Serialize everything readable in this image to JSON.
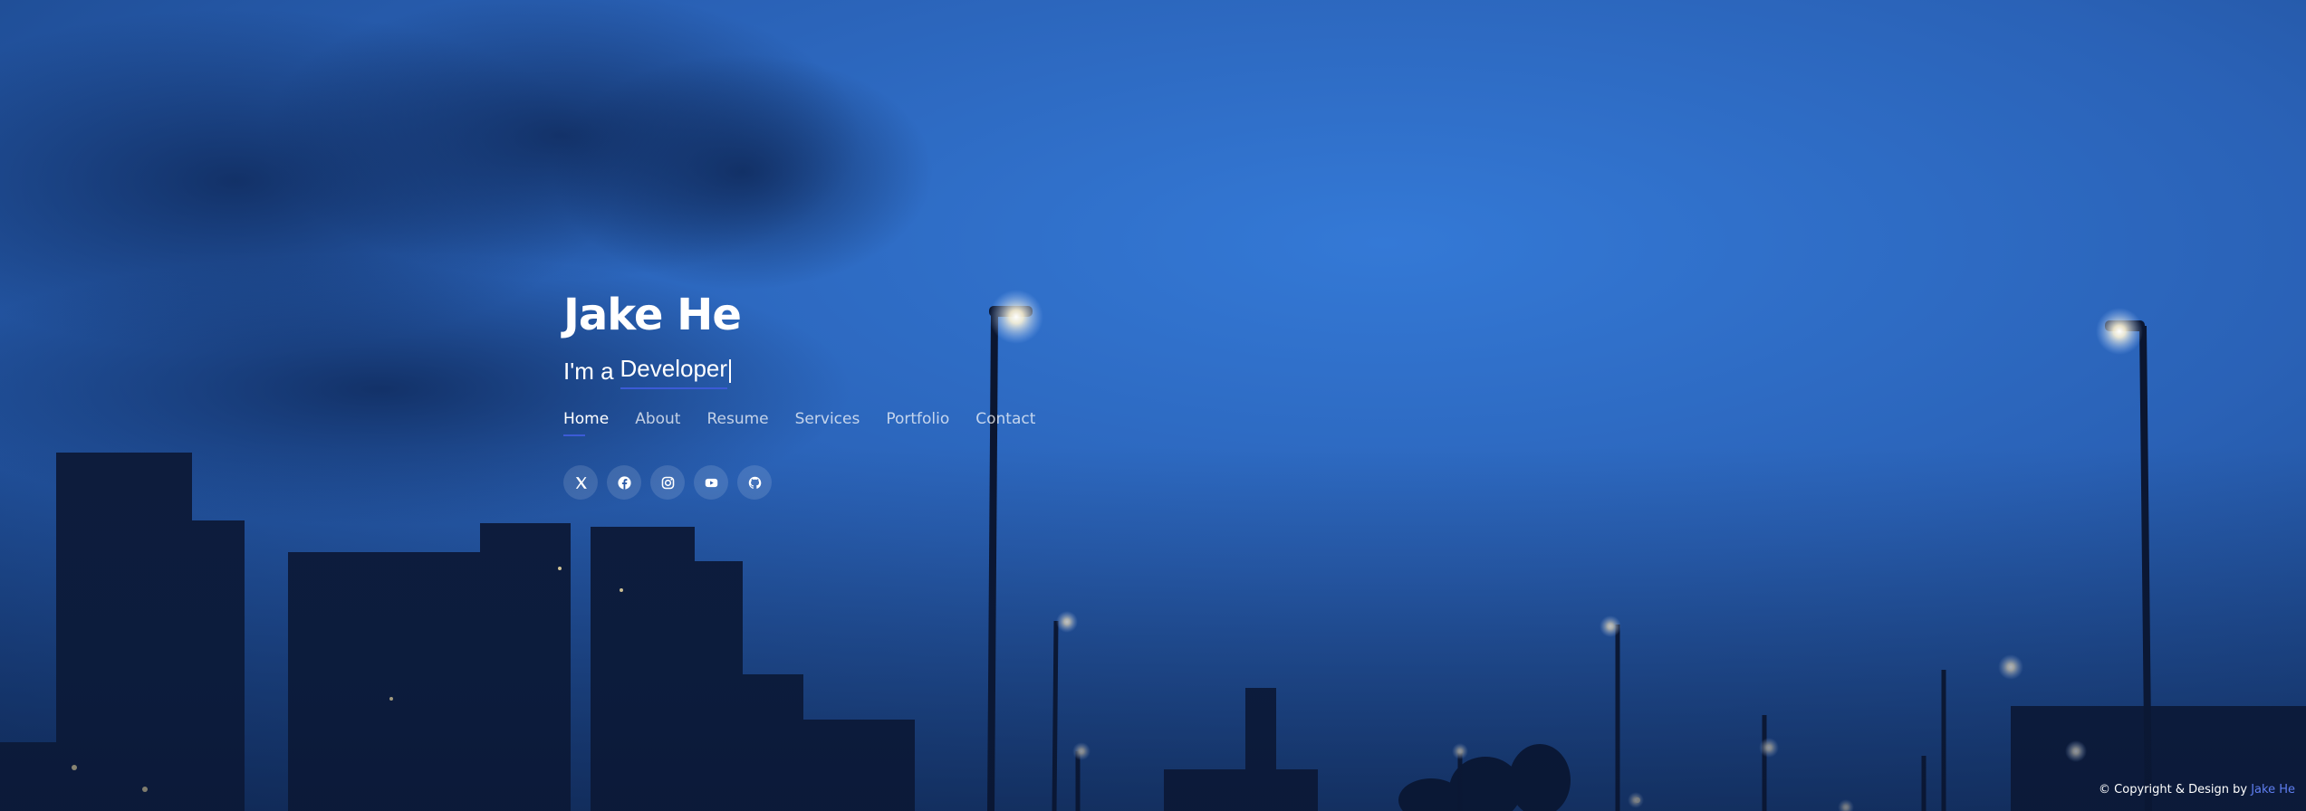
{
  "hero": {
    "name": "Jake He",
    "tagline_prefix": "I'm a",
    "tagline_role": "Developer"
  },
  "nav": {
    "items": [
      {
        "label": "Home",
        "active": true
      },
      {
        "label": "About",
        "active": false
      },
      {
        "label": "Resume",
        "active": false
      },
      {
        "label": "Services",
        "active": false
      },
      {
        "label": "Portfolio",
        "active": false
      },
      {
        "label": "Contact",
        "active": false
      }
    ]
  },
  "social": {
    "icons": [
      "x-twitter-icon",
      "facebook-icon",
      "instagram-icon",
      "youtube-icon",
      "github-icon"
    ]
  },
  "footer": {
    "copyright_text": "© Copyright & Design by",
    "author_link": "Jake He"
  },
  "colors": {
    "accent": "#3c5bd6",
    "link": "#5f7ef0",
    "sky_top": "#1c4a8c",
    "sky_mid": "#2f6fcf",
    "text": "#ffffff"
  }
}
